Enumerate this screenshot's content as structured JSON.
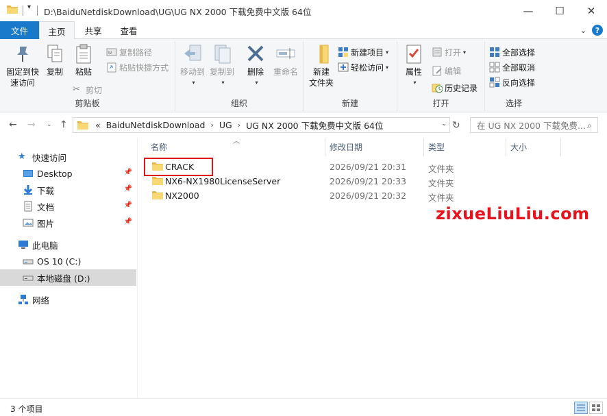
{
  "window": {
    "title": "D:\\BaiduNetdiskDownload\\UG\\UG NX 2000 下载免费中文版 64位",
    "minimize": "—",
    "maximize": "☐",
    "close": "✕"
  },
  "ribbon_tabs": {
    "file": "文件",
    "home": "主页",
    "share": "共享",
    "view": "查看"
  },
  "ribbon": {
    "clipboard": {
      "label": "剪贴板",
      "pin_quick_line1": "固定到快",
      "pin_quick_line2": "速访问",
      "copy": "复制",
      "paste": "粘贴",
      "copy_path": "复制路径",
      "paste_shortcut": "粘贴快捷方式",
      "cut": "剪切"
    },
    "organize": {
      "label": "组织",
      "move_to": "移动到",
      "copy_to": "复制到",
      "delete": "删除",
      "rename": "重命名"
    },
    "new": {
      "label": "新建",
      "new_folder_line1": "新建",
      "new_folder_line2": "文件夹",
      "new_item": "新建项目",
      "easy_access": "轻松访问"
    },
    "open": {
      "label": "打开",
      "properties": "属性",
      "open": "打开",
      "edit": "编辑",
      "history": "历史记录"
    },
    "select": {
      "label": "选择",
      "select_all": "全部选择",
      "select_none": "全部取消",
      "invert": "反向选择"
    }
  },
  "address_bar": {
    "overflow": "«",
    "crumbs": [
      "BaiduNetdiskDownload",
      "UG",
      "UG NX 2000 下载免费中文版 64位"
    ],
    "search_placeholder": "在 UG NX 2000 下载免费..."
  },
  "sidebar": {
    "quick_access": "快速访问",
    "items": [
      {
        "label": "Desktop"
      },
      {
        "label": "下载"
      },
      {
        "label": "文档"
      },
      {
        "label": "图片"
      }
    ],
    "this_pc": "此电脑",
    "drives": [
      {
        "label": "OS 10 (C:)"
      },
      {
        "label": "本地磁盘 (D:)"
      }
    ],
    "network": "网络"
  },
  "columns": {
    "name": "名称",
    "modified": "修改日期",
    "type": "类型",
    "size": "大小"
  },
  "files": [
    {
      "name": "CRACK",
      "modified": "2026/09/21 20:31",
      "type": "文件夹"
    },
    {
      "name": "NX6-NX1980LicenseServer",
      "modified": "2026/09/21 20:33",
      "type": "文件夹"
    },
    {
      "name": "NX2000",
      "modified": "2026/09/21 20:32",
      "type": "文件夹"
    }
  ],
  "watermark": "zixueLiuLiu.com",
  "status": {
    "count": "3 个项目"
  },
  "colors": {
    "accent": "#1979ca",
    "folder": "#f8d775",
    "highlight": "#e01616",
    "watermark": "#e8121c"
  }
}
